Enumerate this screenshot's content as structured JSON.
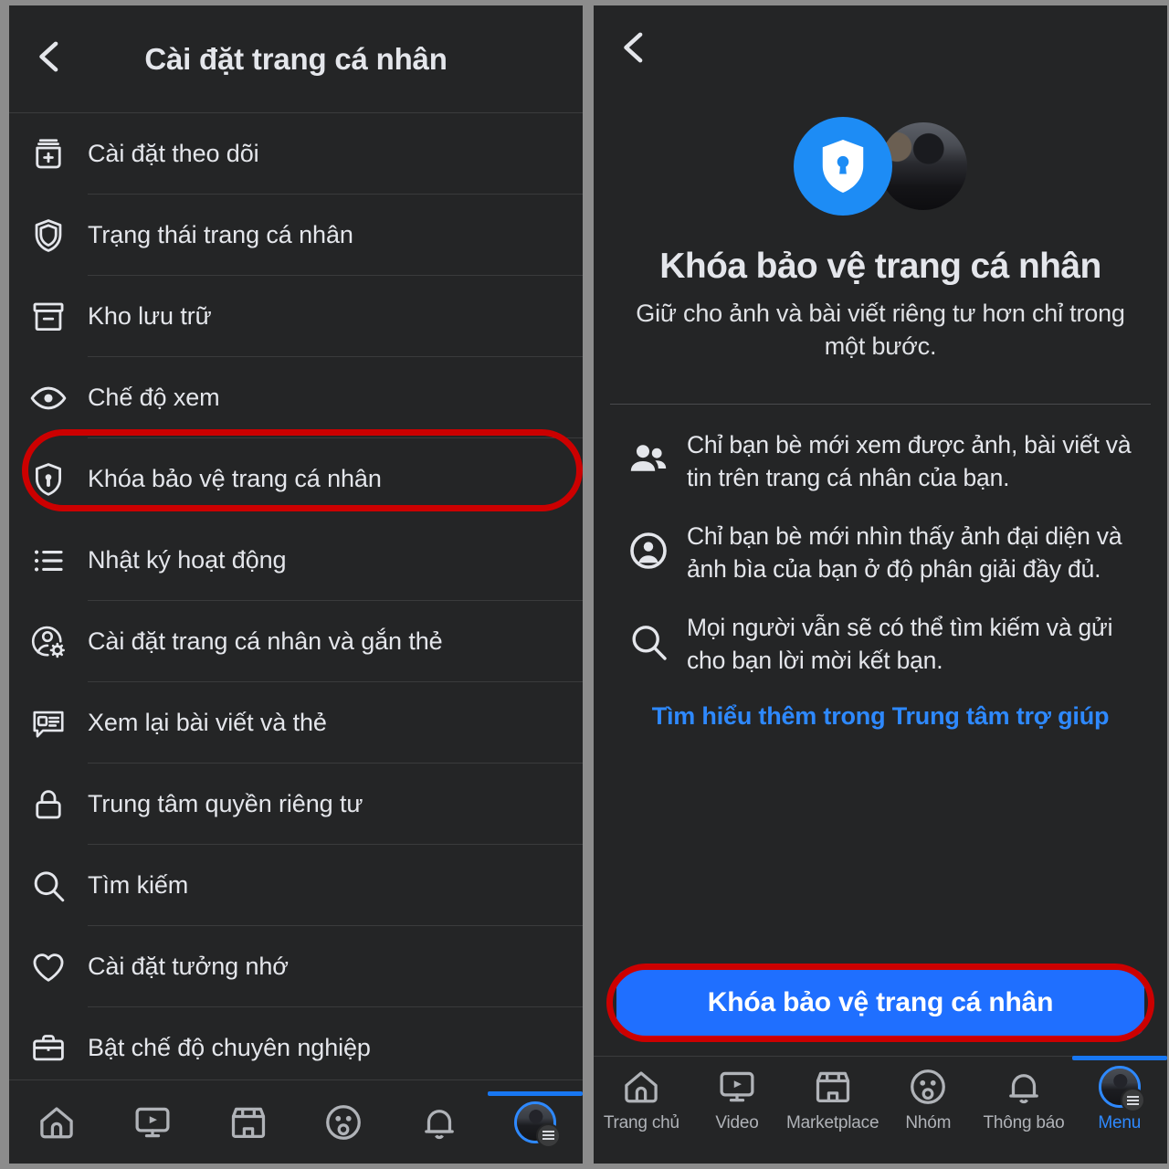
{
  "left": {
    "header": {
      "back_icon": "chevron-left-icon",
      "title": "Cài đặt trang cá nhân"
    },
    "menu_items": [
      {
        "icon": "follow-settings-icon",
        "label": "Cài đặt theo dõi"
      },
      {
        "icon": "shield-icon",
        "label": "Trạng thái trang cá nhân"
      },
      {
        "icon": "archive-icon",
        "label": "Kho lưu trữ"
      },
      {
        "icon": "eye-icon",
        "label": "Chế độ xem"
      },
      {
        "icon": "profile-lock-icon",
        "label": "Khóa bảo vệ trang cá nhân"
      },
      {
        "icon": "activity-log-icon",
        "label": "Nhật ký hoạt động"
      },
      {
        "icon": "profile-tag-settings-icon",
        "label": "Cài đặt trang cá nhân và gắn thẻ"
      },
      {
        "icon": "review-posts-icon",
        "label": "Xem lại bài viết và thẻ"
      },
      {
        "icon": "lock-icon",
        "label": "Trung tâm quyền riêng tư"
      },
      {
        "icon": "search-icon",
        "label": "Tìm kiếm"
      },
      {
        "icon": "heart-icon",
        "label": "Cài đặt tưởng nhớ"
      },
      {
        "icon": "briefcase-icon",
        "label": "Bật chế độ chuyên nghiệp"
      }
    ],
    "highlighted_item_label": "Khóa bảo vệ trang cá nhân"
  },
  "right": {
    "header": {
      "back_icon": "chevron-left-icon"
    },
    "hero": {
      "shield_icon": "profile-lock-shield-icon",
      "avatar": "user-avatar"
    },
    "title": "Khóa bảo vệ trang cá nhân",
    "subtitle": "Giữ cho ảnh và bài viết riêng tư hơn chỉ trong một bước.",
    "features": [
      {
        "icon": "friends-icon",
        "text": "Chỉ bạn bè mới xem được ảnh, bài viết và tin trên trang cá nhân của bạn."
      },
      {
        "icon": "account-circle-icon",
        "text": "Chỉ bạn bè mới nhìn thấy ảnh đại diện và ảnh bìa của bạn ở độ phân giải đầy đủ."
      },
      {
        "icon": "search-icon",
        "text": "Mọi người vẫn sẽ có thể tìm kiếm và gửi cho bạn lời mời kết bạn."
      }
    ],
    "help_link": "Tìm hiểu thêm trong Trung tâm trợ giúp",
    "cta_label": "Khóa bảo vệ trang cá nhân"
  },
  "bottom_nav": {
    "items": [
      {
        "icon": "home-icon",
        "label": "Trang chủ"
      },
      {
        "icon": "video-icon",
        "label": "Video"
      },
      {
        "icon": "marketplace-icon",
        "label": "Marketplace"
      },
      {
        "icon": "groups-icon",
        "label": "Nhóm"
      },
      {
        "icon": "bell-icon",
        "label": "Thông báo"
      },
      {
        "icon": "menu-avatar-icon",
        "label": "Menu"
      }
    ],
    "active_index": 5
  },
  "colors": {
    "background": "#8c8c8c",
    "panel": "#242526",
    "accent_blue": "#1877f2",
    "cta_blue": "#1f6fff",
    "link_blue": "#2e89ff",
    "highlight_red": "#cc0000",
    "text_primary": "#e4e6eb",
    "text_secondary": "#b0b3b8",
    "divider": "#3a3b3c"
  }
}
